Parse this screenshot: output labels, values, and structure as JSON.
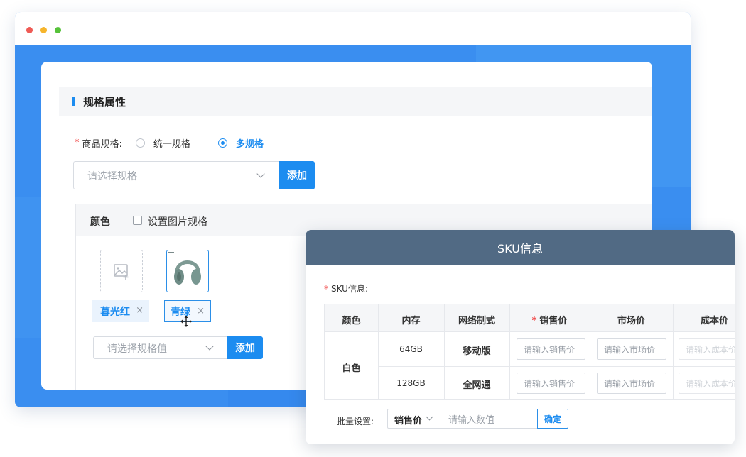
{
  "spec_section": {
    "title": "规格属性",
    "spec_label": "商品规格:",
    "required_mark": "*",
    "radio_unified": "统一规格",
    "radio_multi": "多规格",
    "spec_select_placeholder": "请选择规格",
    "add_label": "添加"
  },
  "spec_group": {
    "name": "颜色",
    "image_spec_label": "设置图片规格",
    "values": [
      {
        "label": "暮光红",
        "has_image": false
      },
      {
        "label": "青绿",
        "has_image": true
      }
    ],
    "remove_glyph": "×",
    "value_select_placeholder": "请选择规格值",
    "add_label": "添加"
  },
  "sku_modal": {
    "title": "SKU信息",
    "sku_label": "SKU信息:",
    "required_mark": "*",
    "columns": [
      "颜色",
      "内存",
      "网络制式",
      "销售价",
      "市场价",
      "成本价"
    ],
    "rows": [
      {
        "color": "白色",
        "memory": "64GB",
        "network": "移动版"
      },
      {
        "color": "白色",
        "memory": "128GB",
        "network": "全网通"
      }
    ],
    "placeholders": {
      "sale_price": "请输入销售价",
      "market_price": "请输入市场价",
      "cost_price": "请输入成本价"
    },
    "batch": {
      "label": "批量设置:",
      "field_value": "销售价",
      "input_placeholder": "请输入数值",
      "confirm_label": "确定"
    }
  },
  "colors": {
    "accent": "#1c8cf0",
    "browser_bg": "#3a8ef0",
    "modal_header": "#516a84",
    "required": "#f04848"
  }
}
